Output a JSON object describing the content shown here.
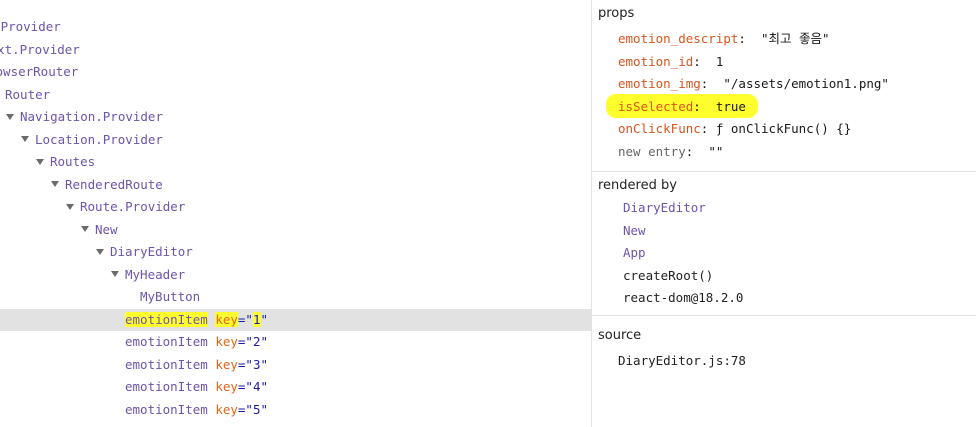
{
  "tree": {
    "rows": [
      {
        "name": "xt.Provider",
        "caret": false,
        "selected": false,
        "highlight": false,
        "key": null
      },
      {
        "name": "text.Provider",
        "caret": false,
        "selected": false,
        "highlight": false,
        "key": null
      },
      {
        "name": "rowserRouter",
        "caret": false,
        "selected": false,
        "highlight": false,
        "key": null
      },
      {
        "name": "Router",
        "caret": false,
        "selected": false,
        "highlight": false,
        "key": null
      },
      {
        "name": "Navigation.Provider",
        "caret": true,
        "selected": false,
        "highlight": false,
        "key": null
      },
      {
        "name": "Location.Provider",
        "caret": true,
        "selected": false,
        "highlight": false,
        "key": null
      },
      {
        "name": "Routes",
        "caret": true,
        "selected": false,
        "highlight": false,
        "key": null
      },
      {
        "name": "RenderedRoute",
        "caret": true,
        "selected": false,
        "highlight": false,
        "key": null
      },
      {
        "name": "Route.Provider",
        "caret": true,
        "selected": false,
        "highlight": false,
        "key": null
      },
      {
        "name": "New",
        "caret": true,
        "selected": false,
        "highlight": false,
        "key": null
      },
      {
        "name": "DiaryEditor",
        "caret": true,
        "selected": false,
        "highlight": false,
        "key": null
      },
      {
        "name": "MyHeader",
        "caret": true,
        "selected": false,
        "highlight": false,
        "key": null
      },
      {
        "name": "MyButton",
        "caret": false,
        "selected": false,
        "highlight": false,
        "key": null
      },
      {
        "name": "emotionItem",
        "caret": false,
        "selected": true,
        "highlight": true,
        "key": "1"
      },
      {
        "name": "emotionItem",
        "caret": false,
        "selected": false,
        "highlight": false,
        "key": "2"
      },
      {
        "name": "emotionItem",
        "caret": false,
        "selected": false,
        "highlight": false,
        "key": "3"
      },
      {
        "name": "emotionItem",
        "caret": false,
        "selected": false,
        "highlight": false,
        "key": "4"
      },
      {
        "name": "emotionItem",
        "caret": false,
        "selected": false,
        "highlight": false,
        "key": "5"
      }
    ],
    "key_label": "key"
  },
  "props": {
    "title": "props",
    "items": [
      {
        "name": "emotion_descript",
        "value": "\"최고 좋음\""
      },
      {
        "name": "emotion_id",
        "value": "1"
      },
      {
        "name": "emotion_img",
        "value": "\"/assets/emotion1.png\""
      },
      {
        "name": "isSelected",
        "value": "true"
      },
      {
        "name": "onClickFunc",
        "value": "ƒ onClickFunc() {}"
      }
    ],
    "new_entry": {
      "name": "new entry",
      "value": "\"\""
    }
  },
  "rendered_by": {
    "title": "rendered by",
    "links": [
      "DiaryEditor",
      "New",
      "App"
    ],
    "texts": [
      "createRoot()",
      "react-dom@18.2.0"
    ]
  },
  "source": {
    "title": "source",
    "file": "DiaryEditor.js:78"
  },
  "colors": {
    "component": "#6e54ad",
    "key": "#e2641c",
    "highlight": "#ffff2e",
    "selected_row": "#e2e2e2"
  }
}
